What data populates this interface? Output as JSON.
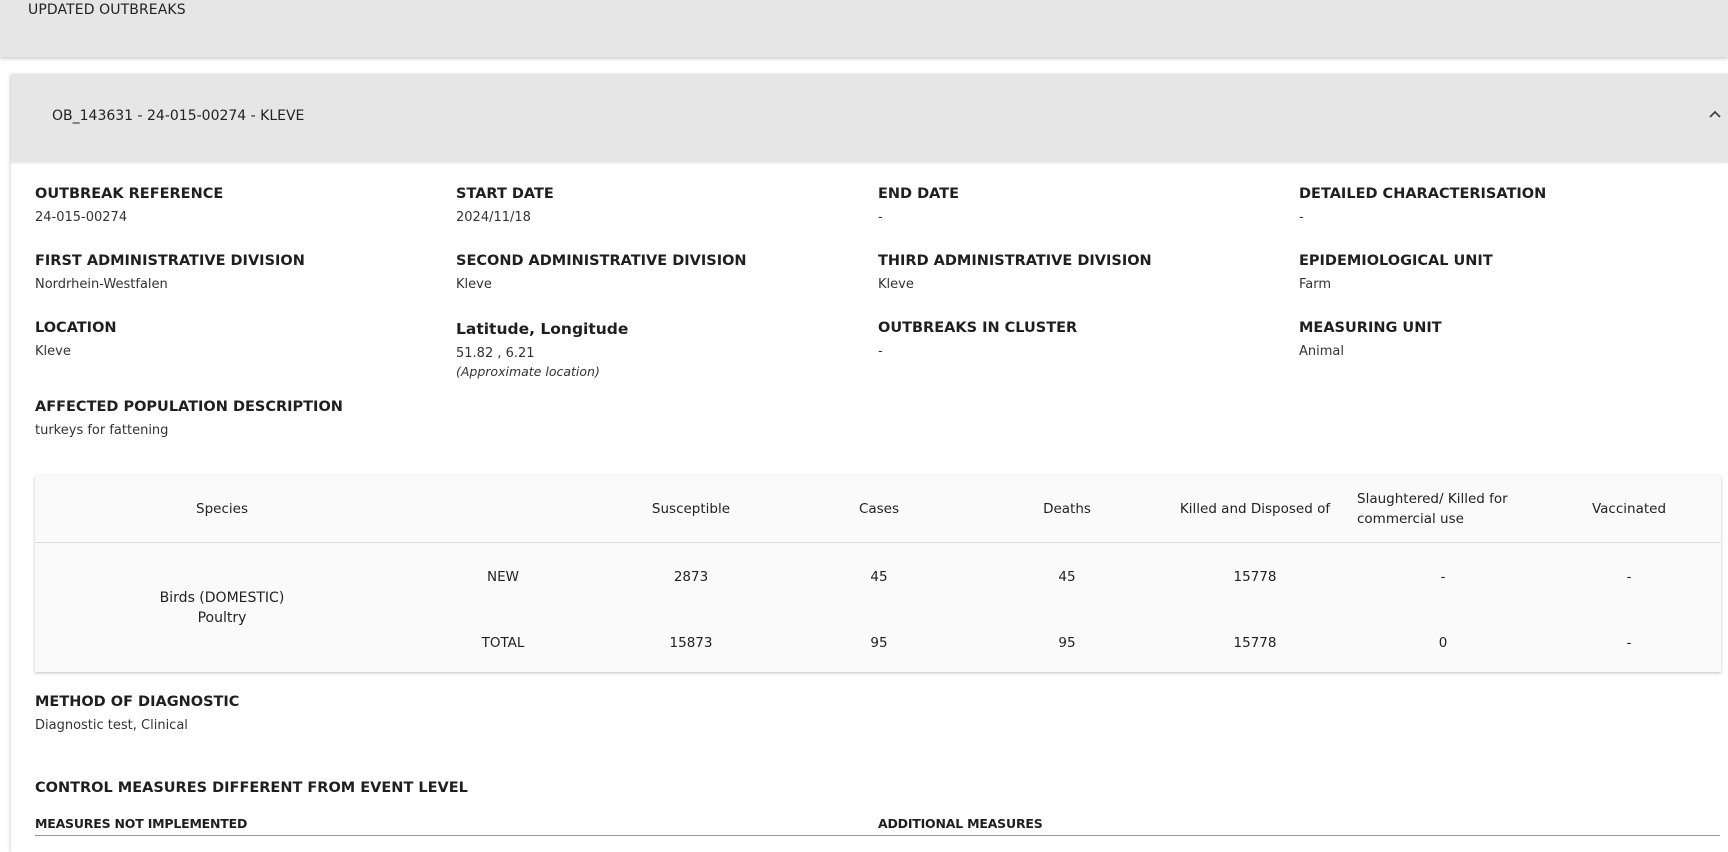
{
  "top_bar": {
    "title": "UPDATED OUTBREAKS"
  },
  "outbreak": {
    "title": "OB_143631 - 24-015-00274 - KLEVE",
    "fields": {
      "outbreak_reference": {
        "label": "OUTBREAK REFERENCE",
        "value": "24-015-00274"
      },
      "start_date": {
        "label": "START DATE",
        "value": "2024/11/18"
      },
      "end_date": {
        "label": "END DATE",
        "value": "-"
      },
      "detailed_characterisation": {
        "label": "DETAILED CHARACTERISATION",
        "value": "-"
      },
      "first_admin_division": {
        "label": "FIRST ADMINISTRATIVE DIVISION",
        "value": "Nordrhein-Westfalen"
      },
      "second_admin_division": {
        "label": "SECOND ADMINISTRATIVE DIVISION",
        "value": "Kleve"
      },
      "third_admin_division": {
        "label": "THIRD ADMINISTRATIVE DIVISION",
        "value": "Kleve"
      },
      "epidemiological_unit": {
        "label": "EPIDEMIOLOGICAL UNIT",
        "value": "Farm"
      },
      "location": {
        "label": "LOCATION",
        "value": "Kleve"
      },
      "lat_long": {
        "label": "Latitude, Longitude",
        "value": "51.82 , 6.21",
        "note": "(Approximate location)"
      },
      "outbreaks_in_cluster": {
        "label": "OUTBREAKS IN CLUSTER",
        "value": "-"
      },
      "measuring_unit": {
        "label": "MEASURING UNIT",
        "value": "Animal"
      },
      "affected_population": {
        "label": "AFFECTED POPULATION DESCRIPTION",
        "value": "turkeys for fattening"
      }
    },
    "table": {
      "headers": {
        "species": "Species",
        "type": "",
        "susceptible": "Susceptible",
        "cases": "Cases",
        "deaths": "Deaths",
        "killed": "Killed and Disposed of",
        "slaughtered": "Slaughtered/ Killed for commercial use",
        "vaccinated": "Vaccinated"
      },
      "species_line1": "Birds (DOMESTIC)",
      "species_line2": "Poultry",
      "rows": [
        {
          "type": "NEW",
          "susceptible": "2873",
          "cases": "45",
          "deaths": "45",
          "killed": "15778",
          "slaughtered": "-",
          "vaccinated": "-"
        },
        {
          "type": "TOTAL",
          "susceptible": "15873",
          "cases": "95",
          "deaths": "95",
          "killed": "15778",
          "slaughtered": "0",
          "vaccinated": "-"
        }
      ]
    },
    "method_of_diagnostic": {
      "label": "METHOD OF DIAGNOSTIC",
      "value": "Diagnostic test, Clinical"
    },
    "control_measures": {
      "label": "CONTROL MEASURES DIFFERENT FROM EVENT LEVEL",
      "not_implemented": "MEASURES NOT IMPLEMENTED",
      "additional": "ADDITIONAL MEASURES"
    }
  }
}
